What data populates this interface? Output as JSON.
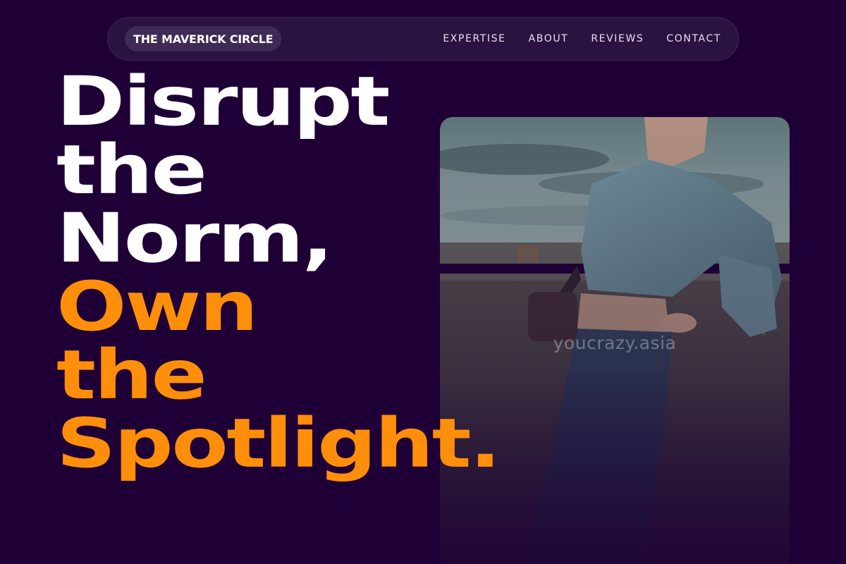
{
  "brand": {
    "name": "THE MAVERICK CIRCLE"
  },
  "nav": {
    "links": [
      "EXPERTISE",
      "ABOUT",
      "REVIEWS",
      "CONTACT"
    ]
  },
  "hero": {
    "lines": [
      {
        "text": "Disrupt",
        "color": "white"
      },
      {
        "text": "the",
        "color": "white"
      },
      {
        "text": "Norm,",
        "color": "white"
      },
      {
        "text": "Own",
        "color": "orange"
      },
      {
        "text": "the",
        "color": "orange"
      },
      {
        "text": "Spotlight.",
        "color": "orange"
      }
    ],
    "watermark": "youcrazy.asia"
  },
  "colors": {
    "background": "#1f0036",
    "accent": "#ff8f0a",
    "text": "#ffffff"
  }
}
